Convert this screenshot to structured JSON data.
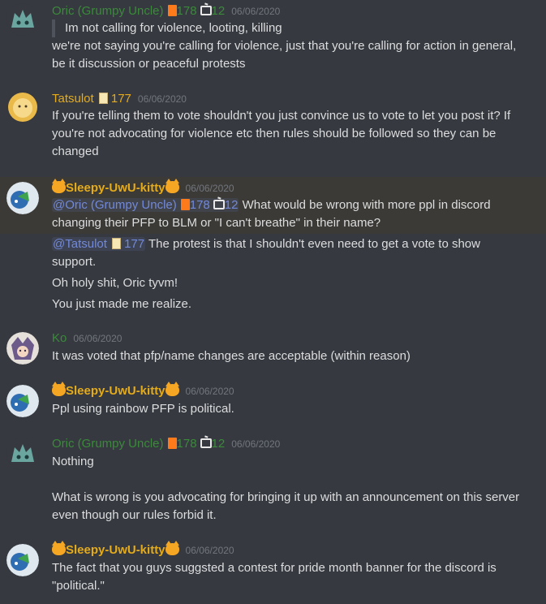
{
  "colors": {
    "background": "#36393f",
    "oric": "#3b8a3b",
    "tatsulot": "#e4ab1c",
    "sleepy": "#e4ab1c",
    "ko": "#3b8a3b",
    "mention": "#7289da",
    "timestamp": "#72767d",
    "text": "#dcddde"
  },
  "messages": [
    {
      "author": "Oric (Grumpy Uncle)",
      "badge_num_1": "178",
      "badge_num_2": "12",
      "timestamp": "06/06/2020",
      "quote": "Im not calling for violence, looting, killing",
      "lines": [
        "we're not saying you're calling for violence, just that you're calling for action in general,",
        "be it discussion or peaceful protests"
      ]
    },
    {
      "author": "Tatsulot",
      "badge_num": "177",
      "timestamp": "06/06/2020",
      "lines": [
        "If you're telling them to vote shouldn't you just convince us to vote to let you post it? If",
        "you're not advocating for violence etc then rules should be followed so they can be",
        "changed"
      ]
    },
    {
      "author": "Sleepy-UwU-kitty",
      "timestamp": "06/06/2020",
      "mention_1": "@Oric (Grumpy Uncle)",
      "mention_1_num_1": "178",
      "mention_1_num_2": "12",
      "line_1_rest": " What would be wrong with more ppl in discord",
      "line_2": "changing their PFP to BLM or \"I can't breathe\" in their name?",
      "mention_2": "@Tatsulot",
      "mention_2_num": "177",
      "line_3_rest": " The protest is that I shouldn't even need to get a vote to show",
      "line_4": "support.",
      "line_5": "Oh holy shit, Oric tyvm!",
      "line_6": "You just made me realize."
    },
    {
      "author": "Ko",
      "timestamp": "06/06/2020",
      "lines": [
        "It was voted that pfp/name changes are acceptable (within reason)"
      ]
    },
    {
      "author": "Sleepy-UwU-kitty",
      "timestamp": "06/06/2020",
      "lines": [
        "Ppl using rainbow PFP is political."
      ]
    },
    {
      "author": "Oric (Grumpy Uncle)",
      "badge_num_1": "178",
      "badge_num_2": "12",
      "timestamp": "06/06/2020",
      "lines": [
        "Nothing",
        "What is wrong is you advocating for bringing it up with an announcement on this server",
        "even though our rules forbid it."
      ]
    },
    {
      "author": "Sleepy-UwU-kitty",
      "timestamp": "06/06/2020",
      "lines": [
        "The fact that you guys suggsted a contest for pride month banner for the discord is",
        "\"political.\""
      ]
    }
  ]
}
